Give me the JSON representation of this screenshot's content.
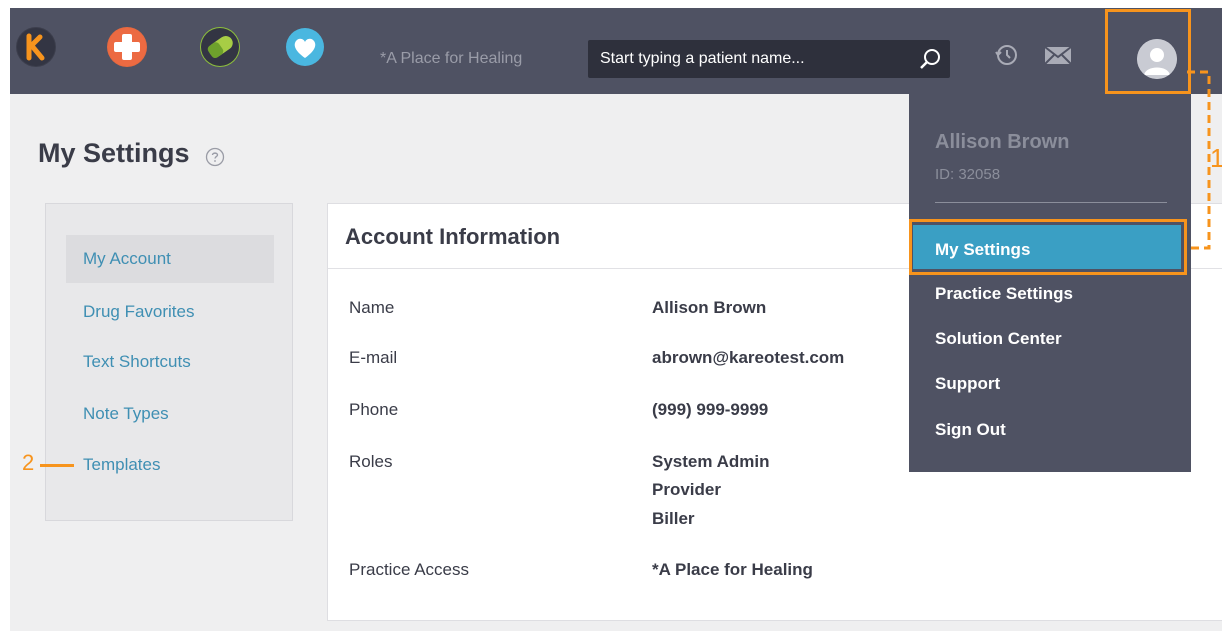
{
  "topbar": {
    "practice_name": "*A Place for Healing",
    "search_placeholder": "Start typing a patient name...",
    "icons": [
      "kareo-logo-icon",
      "medical-cross-icon",
      "pill-icon",
      "heart-icon",
      "search-icon",
      "history-icon",
      "mail-icon",
      "user-avatar-icon"
    ]
  },
  "page": {
    "title": "My Settings"
  },
  "leftnav": {
    "items": [
      {
        "label": "My Account"
      },
      {
        "label": "Drug Favorites"
      },
      {
        "label": "Text Shortcuts"
      },
      {
        "label": "Note Types"
      },
      {
        "label": "Templates"
      }
    ],
    "active_index": 0
  },
  "account": {
    "title": "Account Information",
    "rows": [
      {
        "label": "Name",
        "values": [
          "Allison Brown"
        ]
      },
      {
        "label": "E-mail",
        "values": [
          "abrown@kareotest.com"
        ]
      },
      {
        "label": "Phone",
        "values": [
          "(999) 999-9999"
        ]
      },
      {
        "label": "Roles",
        "values": [
          "System Admin",
          "Provider",
          "Biller"
        ]
      },
      {
        "label": "Practice Access",
        "values": [
          "*A Place for Healing"
        ]
      }
    ]
  },
  "user_menu": {
    "name": "Allison Brown",
    "id": "ID: 32058",
    "items": [
      {
        "label": "My Settings"
      },
      {
        "label": "Practice Settings"
      },
      {
        "label": "Solution Center"
      },
      {
        "label": "Support"
      },
      {
        "label": "Sign Out"
      }
    ],
    "active_index": 0
  },
  "annotations": {
    "callout_1": "1",
    "callout_2": "2"
  },
  "colors": {
    "topbar": "#4f5263",
    "accent_orange": "#f7941d",
    "active_blue": "#3a9fc4",
    "link_blue": "#3f8fb3"
  }
}
